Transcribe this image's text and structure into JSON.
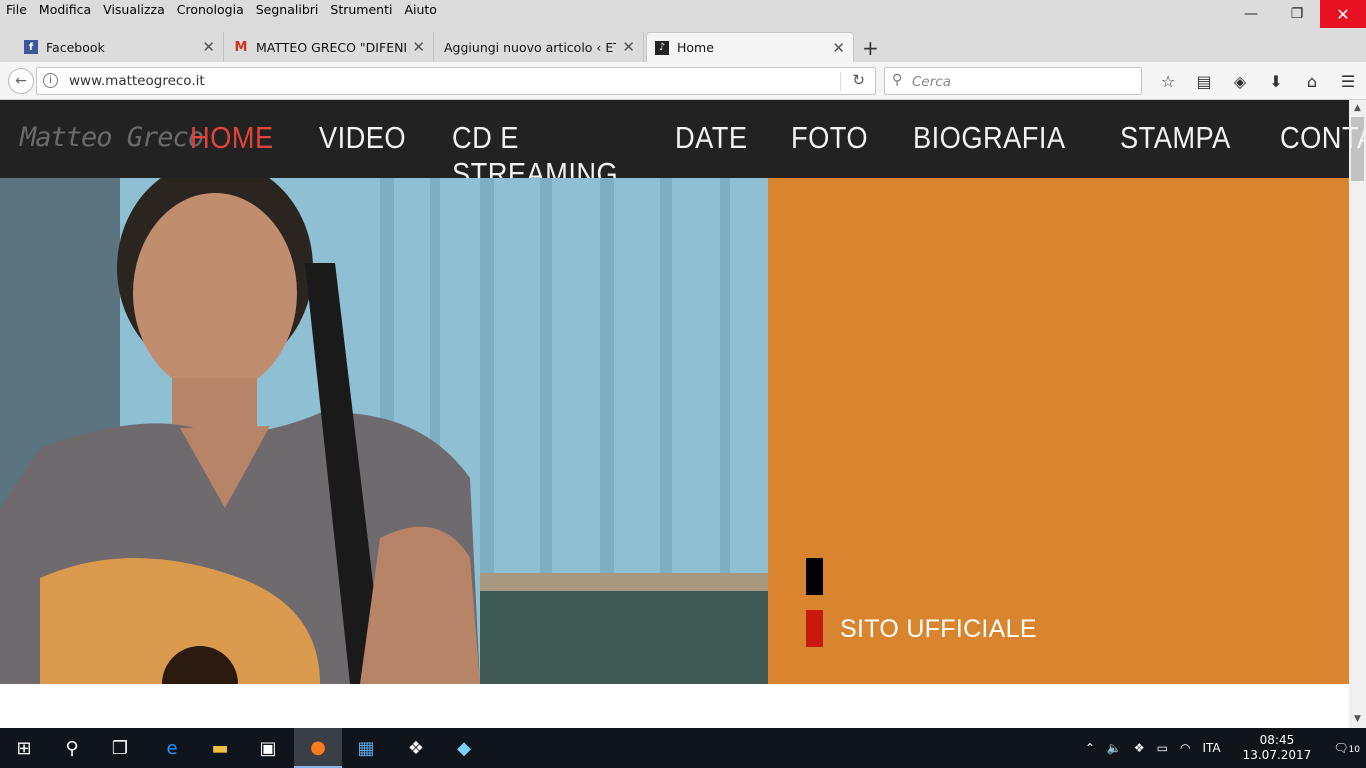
{
  "menubar": {
    "items": [
      "File",
      "Modifica",
      "Visualizza",
      "Cronologia",
      "Segnalibri",
      "Strumenti",
      "Aiuto"
    ]
  },
  "window_controls": {
    "minimize": "—",
    "restore": "❐",
    "close": "✕"
  },
  "tabs": [
    {
      "title": "Facebook",
      "icon": "facebook-icon"
    },
    {
      "title": "MATTEO GRECO \"DIFENDIAMO",
      "icon": "gmail-icon"
    },
    {
      "title": "Aggiungi nuovo articolo ‹ ETiCinema",
      "icon": "none"
    },
    {
      "title": "Home",
      "icon": "site-favicon",
      "active": true
    }
  ],
  "navbar": {
    "url": "www.matteogreco.it",
    "search_placeholder": "Cerca"
  },
  "site": {
    "logo": "Matteo Greco",
    "nav": [
      "HOME",
      "VIDEO",
      "CD E STREAMING",
      "DATE",
      "FOTO",
      "BIOGRAFIA",
      "STAMPA",
      "CONTATTI"
    ],
    "active_nav": "HOME",
    "tagline": "SITO UFFICIALE",
    "colors": {
      "nav_bg": "#222222",
      "active": "#e2433a",
      "orange": "#d98530",
      "accent_red": "#c8190d"
    }
  },
  "taskbar": {
    "language": "ITA",
    "time": "08:45",
    "date": "13.07.2017",
    "notifications": "10"
  }
}
